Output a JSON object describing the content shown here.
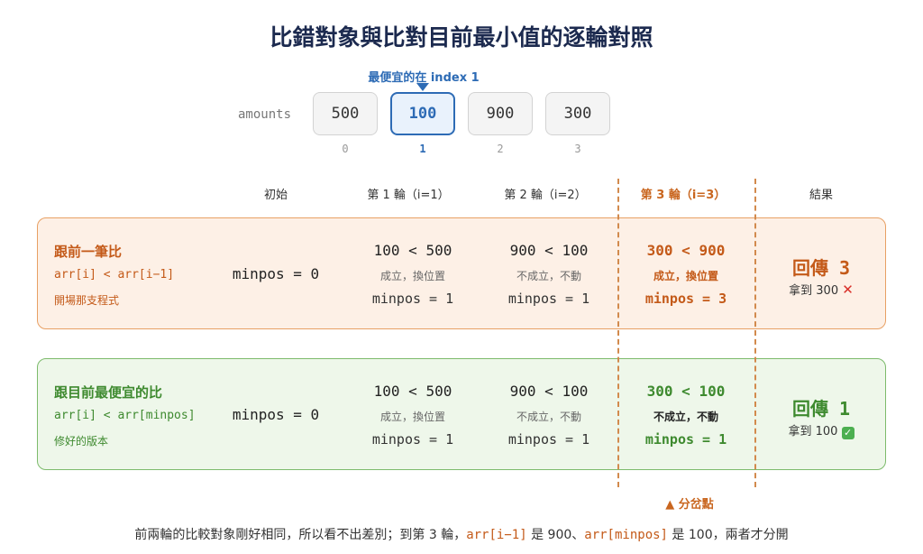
{
  "title": "比錯對象與比對目前最小值的逐輪對照",
  "pointer_label": "最便宜的在 index 1",
  "amounts": {
    "label": "amounts",
    "values": [
      "500",
      "100",
      "900",
      "300"
    ],
    "indices": [
      "0",
      "1",
      "2",
      "3"
    ],
    "highlight_index": 1
  },
  "columns": {
    "init": "初始",
    "round1": "第 1 輪（i=1）",
    "round2": "第 2 輪（i=2）",
    "round3": "第 3 輪（i=3）",
    "result": "結果"
  },
  "row_wrong": {
    "title": "跟前一筆比",
    "code": "arr[i] < arr[i−1]",
    "desc": "開場那支程式",
    "init": "minpos = 0",
    "r1": {
      "cmp": "100 < 500",
      "note": "成立，換位置",
      "minpos": "minpos = 1"
    },
    "r2": {
      "cmp": "900 < 100",
      "note": "不成立，不動",
      "minpos": "minpos = 1"
    },
    "r3": {
      "cmp": "300 < 900",
      "note": "成立，換位置",
      "minpos": "minpos = 3"
    },
    "result": {
      "main": "回傳 3",
      "sub": "拿到 300",
      "mark_icon": "cross-mark-icon",
      "mark": "✕"
    }
  },
  "row_right": {
    "title": "跟目前最便宜的比",
    "code": "arr[i] < arr[minpos]",
    "desc": "修好的版本",
    "init": "minpos = 0",
    "r1": {
      "cmp": "100 < 500",
      "note": "成立，換位置",
      "minpos": "minpos = 1"
    },
    "r2": {
      "cmp": "900 < 100",
      "note": "不成立，不動",
      "minpos": "minpos = 1"
    },
    "r3": {
      "cmp": "300 < 100",
      "note": "不成立，不動",
      "minpos": "minpos = 1"
    },
    "result": {
      "main": "回傳 1",
      "sub": "拿到 100",
      "mark_icon": "check-mark-icon",
      "mark": "✓"
    }
  },
  "diverge_label": "▲ 分岔點",
  "footer": {
    "part1": "前兩輪的比較對象剛好相同，所以看不出差別；到第 3 輪，",
    "code1": "arr[i−1]",
    "part2": " 是 900、",
    "code2": "arr[minpos]",
    "part3": " 是 100，兩者才分開"
  },
  "colors": {
    "title": "#1c2a4f",
    "accent_blue": "#2d6bb5",
    "accent_orange": "#c45a19",
    "accent_green": "#3e8a2f",
    "panel_orange_bg": "#fdf0e6",
    "panel_green_bg": "#eef7ea"
  }
}
